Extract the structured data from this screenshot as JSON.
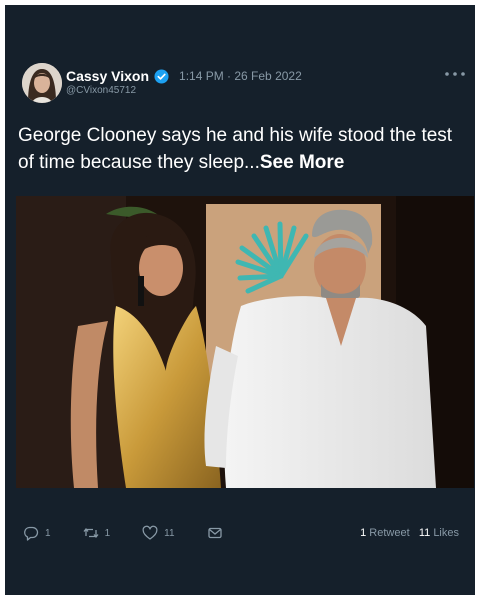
{
  "tweet": {
    "author_name": "Cassy Vixon",
    "handle": "@CVixon45712",
    "timestamp": "1:14 PM · 26 Feb 2022",
    "text": "George Clooney says he and his wife stood the test of time because they sleep...",
    "see_more": "See More"
  },
  "actions": {
    "reply_count": "1",
    "retweet_count": "1",
    "like_count": "11"
  },
  "stats": {
    "retweet_num": "1",
    "retweet_label": "Retweet",
    "likes_num": "11",
    "likes_label": "Likes"
  },
  "colors": {
    "background": "#15202b",
    "verified": "#1da1f2",
    "muted": "#8899a6"
  },
  "icons": [
    "verified-badge-icon",
    "more-icon",
    "reply-icon",
    "retweet-icon",
    "like-icon",
    "share-icon"
  ]
}
